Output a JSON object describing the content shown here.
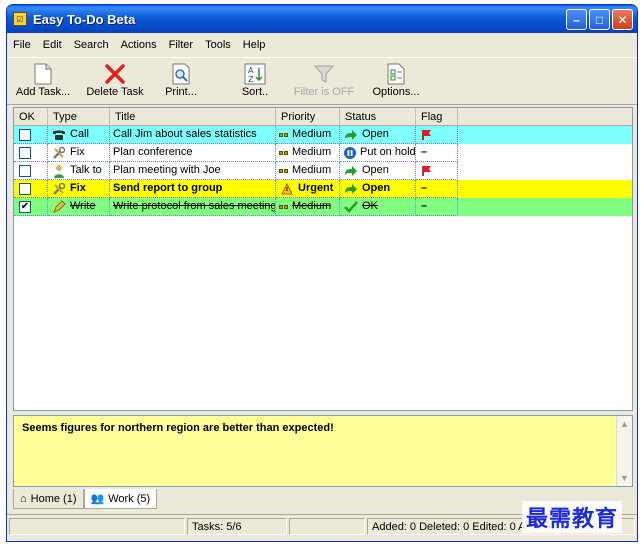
{
  "window": {
    "title": "Easy To-Do Beta"
  },
  "menu": [
    "File",
    "Edit",
    "Search",
    "Actions",
    "Filter",
    "Tools",
    "Help"
  ],
  "toolbar": {
    "add_task": "Add Task...",
    "delete_task": "Delete Task",
    "print": "Print...",
    "sort": "Sort..",
    "filter": "Filter is OFF",
    "options": "Options..."
  },
  "columns": {
    "ok": "OK",
    "type": "Type",
    "title": "Title",
    "priority": "Priority",
    "status": "Status",
    "flag": "Flag"
  },
  "tasks": [
    {
      "done": false,
      "type": "Call",
      "type_icon": "phone-icon",
      "title": "Call Jim about sales statistics",
      "priority": "Medium",
      "status": "Open",
      "status_icon": "arrow-right-icon",
      "flag": "red-flag",
      "bg": "#80ffff",
      "bold": false,
      "strike": false
    },
    {
      "done": false,
      "type": "Fix",
      "type_icon": "tools-icon",
      "title": "Plan conference",
      "priority": "Medium",
      "status": "Put on hold",
      "status_icon": "pause-icon",
      "flag": "dash",
      "bg": "#ffffff",
      "bold": false,
      "strike": false
    },
    {
      "done": false,
      "type": "Talk to",
      "type_icon": "person-icon",
      "title": "Plan meeting with Joe",
      "priority": "Medium",
      "status": "Open",
      "status_icon": "arrow-right-icon",
      "flag": "red-flag",
      "bg": "#ffffff",
      "bold": false,
      "strike": false
    },
    {
      "done": false,
      "type": "Fix",
      "type_icon": "tools-icon",
      "title": "Send report to group",
      "priority": "Urgent",
      "status": "Open",
      "status_icon": "arrow-right-icon",
      "flag": "dash",
      "bg": "#ffff00",
      "bold": true,
      "strike": false
    },
    {
      "done": true,
      "type": "Write",
      "type_icon": "pencil-icon",
      "title": "Write protocol from sales meeting",
      "priority": "Medium",
      "status": "OK",
      "status_icon": "check-icon",
      "flag": "dash",
      "bg": "#80ff80",
      "bold": false,
      "strike": true
    }
  ],
  "notes": {
    "text": "Seems figures for northern region are better than expected!"
  },
  "tabs": [
    {
      "label": "Home (1)",
      "icon": "home-icon"
    },
    {
      "label": "Work (5)",
      "icon": "people-icon"
    }
  ],
  "status": {
    "tasks": "Tasks: 5/6",
    "counts": "Added: 0 Deleted: 0 Edited: 0 A"
  },
  "watermark": "最需教育"
}
